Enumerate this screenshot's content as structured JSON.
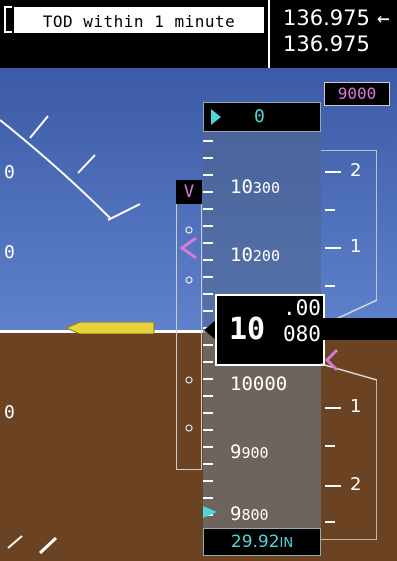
{
  "message": {
    "text": "TOD within 1 minute"
  },
  "com": {
    "active": "136.975",
    "standby": "136.975",
    "swap_icon": "left-arrow-icon"
  },
  "altitude": {
    "selected": "0",
    "target_display": "9000",
    "current_main": "10",
    "current_roll_top": ".00",
    "current_roll_bottom": "080",
    "tape_labels": [
      {
        "big": "10",
        "small": "300"
      },
      {
        "big": "10",
        "small": "200"
      },
      {
        "big": "10",
        "small": "000"
      },
      {
        "big": "9",
        "small": "900"
      },
      {
        "big": "9",
        "small": "800"
      }
    ],
    "baro": "29.92",
    "baro_unit": "IN"
  },
  "vnav": {
    "label": "V"
  },
  "vsi": {
    "labels_top": [
      "2",
      "1"
    ],
    "labels_bottom": [
      "1",
      "2"
    ]
  },
  "colors": {
    "sky": "#4a6bb8",
    "ground": "#6b4322",
    "cyan": "#4fd6d6",
    "magenta": "#d67bd6"
  }
}
